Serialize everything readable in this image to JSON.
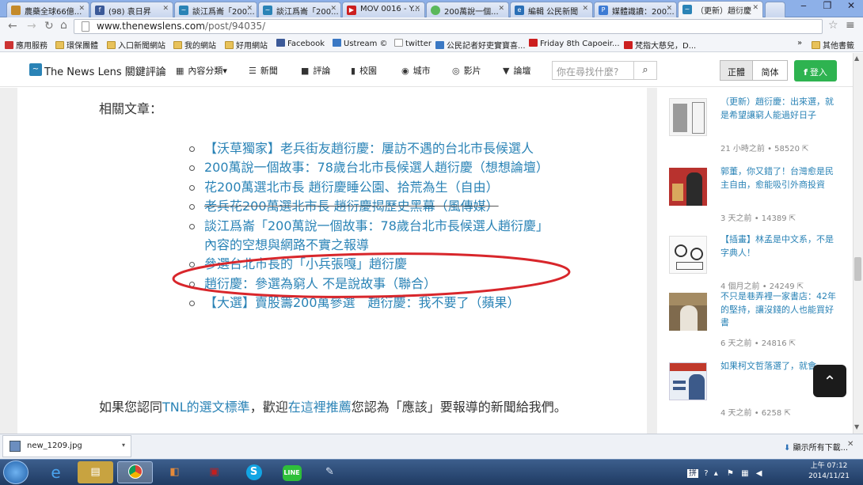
{
  "browser": {
    "tabs": [
      {
        "title": "農藥全球66億..."
      },
      {
        "title": "(98) 袁日昇"
      },
      {
        "title": "談江爲崙「200..."
      },
      {
        "title": "談江爲崙「200..."
      },
      {
        "title": "MOV 0016 - Y..."
      },
      {
        "title": "200萬說一個..."
      },
      {
        "title": "編輯 公民新聞"
      },
      {
        "title": "媒體識讀：200..."
      },
      {
        "title": "（更新）趙衍慶"
      }
    ],
    "url_host": "www.thenewslens.com",
    "url_path": "/post/94035/",
    "bookmarks": [
      "應用服務",
      "環保團體",
      "入口新聞網站",
      "我的網站",
      "好用網站",
      "Facebook",
      "Ustream ©",
      "twitter",
      "公民記者好吏實寶喜...",
      "Friday 8th Capoeir...",
      "梵指大慈兒，D..."
    ],
    "bookmarks_more": "»",
    "other_bookmarks": "其他書籤"
  },
  "site": {
    "logo_text": "The News Lens 關鍵評論",
    "nav": [
      "內容分類",
      "新聞",
      "評論",
      "校園",
      "城市",
      "影片",
      "論壇"
    ],
    "nav_caret": "▾",
    "search_placeholder": "你在尋找什麼?",
    "lang_traditional": "正體",
    "lang_simplified": "简体",
    "login": "登入"
  },
  "article": {
    "heading": "相關文章：",
    "related": [
      "【沃草獨家】老兵街友趙衍慶：屢訪不遇的台北市長候選人",
      "200萬說一個故事：78歲台北市長候選人趙衍慶（想想論壇）",
      "花200萬選北市長 趙衍慶睡公園、拾荒為生（自由）",
      "老兵花200萬選北市長 趙衍慶揭歷史黑幕（風傳媒）",
      "談江爲崙「200萬說一個故事：78歲台北市長候選人趙衍慶」內容的空想與網路不實之報導",
      "參選台北市長的「小兵張嘎」趙衍慶",
      "趙衍慶：參選為窮人 不是說故事（聯合）",
      "【大選】賣股籌200萬參選　趙衍慶：我不要了（蘋果）"
    ],
    "endorse_pre": "如果您認同",
    "endorse_link1": "TNL的選文標準",
    "endorse_mid": "，歡迎",
    "endorse_link2": "在這裡推薦",
    "endorse_post": "您認為「應該」要報導的新聞給我們。"
  },
  "sidebar": [
    {
      "title": "（更新）趙衍慶：出來選，就是希望讓窮人能過好日子",
      "meta": "21 小時之前 • 58520"
    },
    {
      "title": "郭董，你又錯了！台灣愈是民主自由，愈能吸引外商投資",
      "meta": "3 天之前 • 14389"
    },
    {
      "title": "【插畫】林孟是中文系，不是字典人！",
      "meta": "4 個月之前 • 24249"
    },
    {
      "title": "不只是巷弄裡一家書店：42年的堅持，讓沒錢的人也能買好書",
      "meta": "6 天之前 • 24816"
    },
    {
      "title": "如果柯文哲落選了，就會......",
      "meta": "4 天之前 • 6258"
    }
  ],
  "downloads": {
    "file": "new_1209.jpg",
    "show_all": "顯示所有下載..."
  },
  "taskbar": {
    "time": "上午 07:12",
    "date": "2014/11/21"
  },
  "colors": {
    "link": "#2a83b6",
    "login_green": "#2eb350",
    "annotation_red": "#d8262b"
  }
}
